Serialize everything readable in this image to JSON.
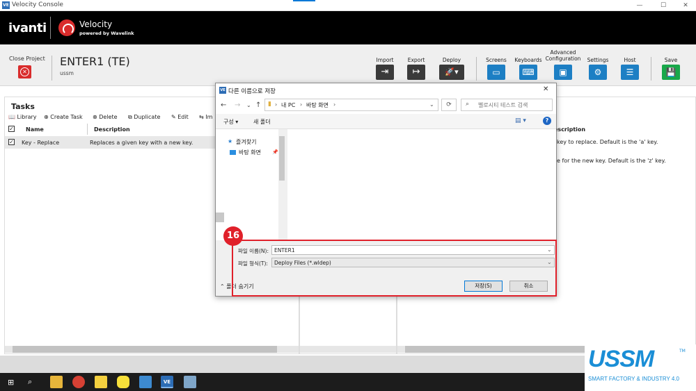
{
  "window": {
    "title": "Velocity Console",
    "minimize": "—",
    "maximize": "☐",
    "close": "✕"
  },
  "brand": {
    "company": "ivanti",
    "product": "Velocity",
    "tagline": "powered by Wavelink"
  },
  "toolbar": {
    "close_project": "Close Project",
    "project_name": "ENTER1 (TE)",
    "project_sub": "ussm",
    "buttons": {
      "import": "Import",
      "export": "Export",
      "deploy": "Deploy",
      "screens": "Screens",
      "keyboards": "Keyboards",
      "advanced_1": "Advanced",
      "advanced_2": "Configuration",
      "settings": "Settings",
      "host": "Host",
      "save": "Save"
    }
  },
  "tasks": {
    "title": "Tasks",
    "actions": {
      "library": "Library",
      "create": "Create Task",
      "delete": "Delete",
      "duplicate": "Duplicate",
      "edit": "Edit",
      "import": "Im"
    },
    "columns": {
      "name": "Name",
      "description": "Description"
    },
    "rows": [
      {
        "name": "Key - Replace",
        "description": "Replaces a given key with a new key.",
        "checked": true
      }
    ]
  },
  "details": {
    "column_description": "escription",
    "row1": "key to replace. Default is the 'a' key.",
    "row2": "e for the new key. Default is the 'z' key."
  },
  "dialog": {
    "title": "다른 이름으로 저장",
    "path": {
      "root": "내 PC",
      "folder": "바탕 화면"
    },
    "search_placeholder": "벨로시티 테스트 검색",
    "organize": "구성 ▾",
    "new_folder": "새 폴더",
    "nav": {
      "favorites": "즐겨찾기",
      "desktop": "바탕 화면"
    },
    "filename_label": "파일 이름(N):",
    "filename_value": "ENTER1",
    "filetype_label": "파일 형식(T):",
    "filetype_value": "Deploy Files (*.wldep)",
    "hide_folders": "폴더 숨기기",
    "save": "저장(S)",
    "cancel": "취소"
  },
  "annotation": {
    "step": "16",
    "color": "#e0202a"
  },
  "logo": {
    "main": "USSM",
    "sub": "SMART FACTORY & INDUSTRY 4.0",
    "tm": "TM"
  },
  "colors": {
    "accent_red": "#d92c2c",
    "accent_blue": "#1d7fc4",
    "save_green": "#18a84a",
    "brand_black": "#000000"
  }
}
